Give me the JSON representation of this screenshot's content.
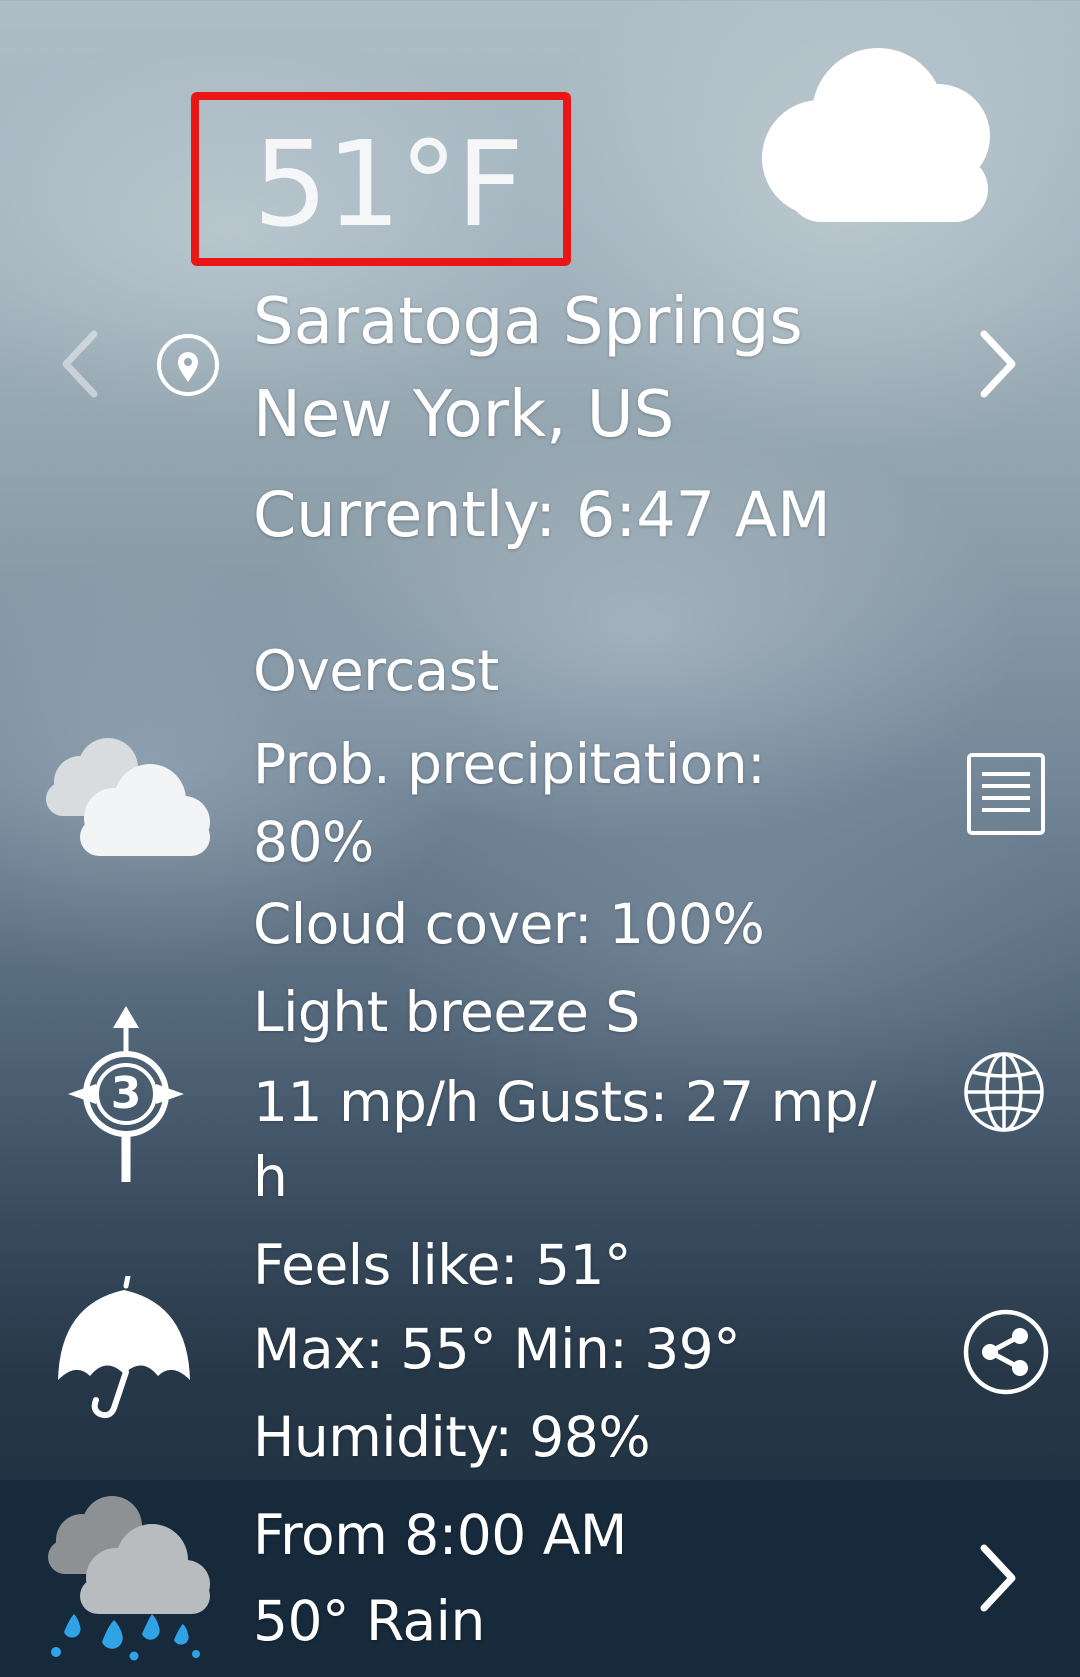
{
  "current": {
    "temperature": "51°F",
    "city": "Saratoga Springs",
    "region": "New York, US",
    "time": "Currently: 6:47 AM"
  },
  "conditions": {
    "summary": "Overcast",
    "precip_label": "Prob. precipitation:",
    "precip_value": "80%",
    "cloud_cover": "Cloud cover: 100%"
  },
  "wind": {
    "description": "Light breeze S",
    "speed_line1": "11 mp/h Gusts: 27 mp/",
    "speed_line2": "h",
    "beaufort": "3"
  },
  "details": {
    "feels_like": "Feels like: 51°",
    "max_min": "Max: 55° Min: 39°",
    "humidity": "Humidity: 98%"
  },
  "forecast": {
    "from": "From 8:00 AM",
    "summary": "50° Rain"
  },
  "icons": {
    "current_weather": "cloud-icon",
    "location": "location-pin-icon",
    "prev": "chevron-left-icon",
    "next": "chevron-right-icon",
    "conditions": "overcast-clouds-icon",
    "details": "document-icon",
    "wind": "wind-compass-icon",
    "map": "globe-icon",
    "umbrella": "umbrella-icon",
    "share": "share-icon",
    "forecast_weather": "rain-cloud-icon",
    "forecast_next": "chevron-right-icon"
  },
  "colors": {
    "highlight": "#ea1515",
    "forecast_bar": "#162a3b"
  }
}
